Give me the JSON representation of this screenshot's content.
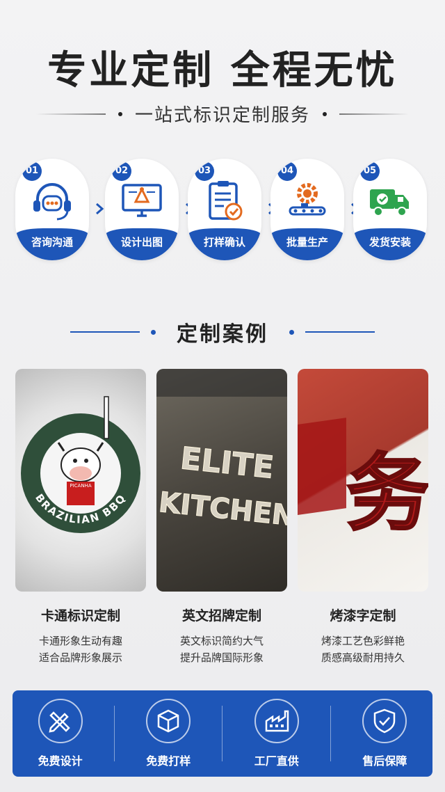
{
  "hero": {
    "title": "专业定制 全程无忧",
    "subtitle": "一站式标识定制服务"
  },
  "steps": [
    {
      "num": "01",
      "label": "咨询沟通",
      "icon": "headset-chat-icon"
    },
    {
      "num": "02",
      "label": "设计出图",
      "icon": "design-monitor-icon"
    },
    {
      "num": "03",
      "label": "打样确认",
      "icon": "clipboard-check-icon"
    },
    {
      "num": "04",
      "label": "批量生产",
      "icon": "gear-conveyor-icon"
    },
    {
      "num": "05",
      "label": "发货安装",
      "icon": "delivery-truck-icon"
    }
  ],
  "cases_section": {
    "title": "定制案例"
  },
  "cases": [
    {
      "title": "卡通标识定制",
      "desc1": "卡通形象生动有趣",
      "desc2": "适合品牌形象展示",
      "image_text": [
        "BRAZILIAN BBQ",
        "PICANHA"
      ]
    },
    {
      "title": "英文招牌定制",
      "desc1": "英文标识简约大气",
      "desc2": "提升品牌国际形象",
      "image_text": [
        "ELITE",
        "KITCHEN"
      ]
    },
    {
      "title": "烤漆字定制",
      "desc1": "烤漆工艺色彩鲜艳",
      "desc2": "质感高级耐用持久",
      "image_text": [
        "务"
      ]
    }
  ],
  "features": [
    {
      "label": "免费设计",
      "icon": "pencil-ruler-icon"
    },
    {
      "label": "免费打样",
      "icon": "cube-icon"
    },
    {
      "label": "工厂直供",
      "icon": "factory-icon"
    },
    {
      "label": "售后保障",
      "icon": "shield-check-icon"
    }
  ],
  "colors": {
    "accent": "#1e56b8",
    "highlight": "#e36a1f",
    "green": "#2ea44f"
  }
}
